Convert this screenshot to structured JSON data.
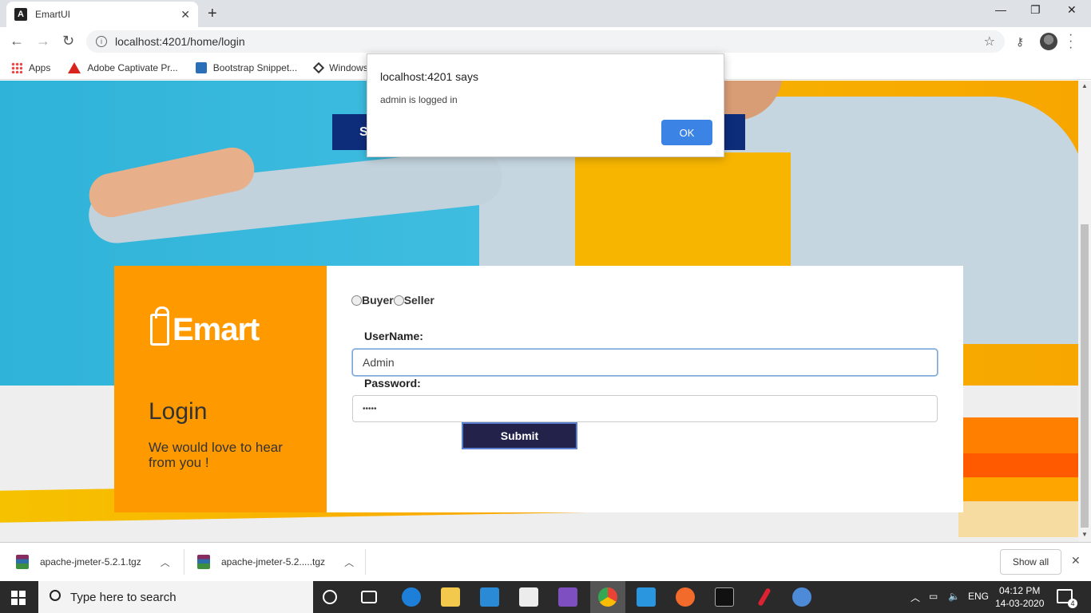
{
  "browser": {
    "tab_title": "EmartUI",
    "tab_icon_letter": "A",
    "url": "localhost:4201/home/login",
    "bookmarks": [
      {
        "label": "Apps",
        "icon": "apps-grid-icon"
      },
      {
        "label": "Adobe Captivate Pr...",
        "icon": "adobe-icon"
      },
      {
        "label": "Bootstrap Snippet...",
        "icon": "bootstrap-icon"
      },
      {
        "label": "Windows",
        "icon": "windows-bookmark-icon"
      }
    ]
  },
  "hero": {
    "button_label": "S"
  },
  "login": {
    "logo_text": "Emart",
    "title": "Login",
    "subtitle": "We would love to hear from you !",
    "role_buyer": "Buyer",
    "role_seller": "Seller",
    "username_label": "UserName:",
    "username_value": "Admin",
    "password_label": "Password:",
    "password_value": "•••••",
    "submit_label": "Submit"
  },
  "alert": {
    "origin": "localhost:4201 says",
    "message": "admin is logged in",
    "ok_label": "OK"
  },
  "downloads": {
    "items": [
      {
        "name": "apache-jmeter-5.2.1.tgz"
      },
      {
        "name": "apache-jmeter-5.2.....tgz"
      }
    ],
    "show_all_label": "Show all"
  },
  "taskbar": {
    "search_placeholder": "Type here to search",
    "language": "ENG",
    "time": "04:12 PM",
    "date": "14-03-2020",
    "notification_count": "4"
  },
  "colors": {
    "brand_orange": "#ff9900",
    "submit_bg": "#22224a",
    "alert_ok": "#3b83e4",
    "hero_button": "#0d2c7a"
  }
}
